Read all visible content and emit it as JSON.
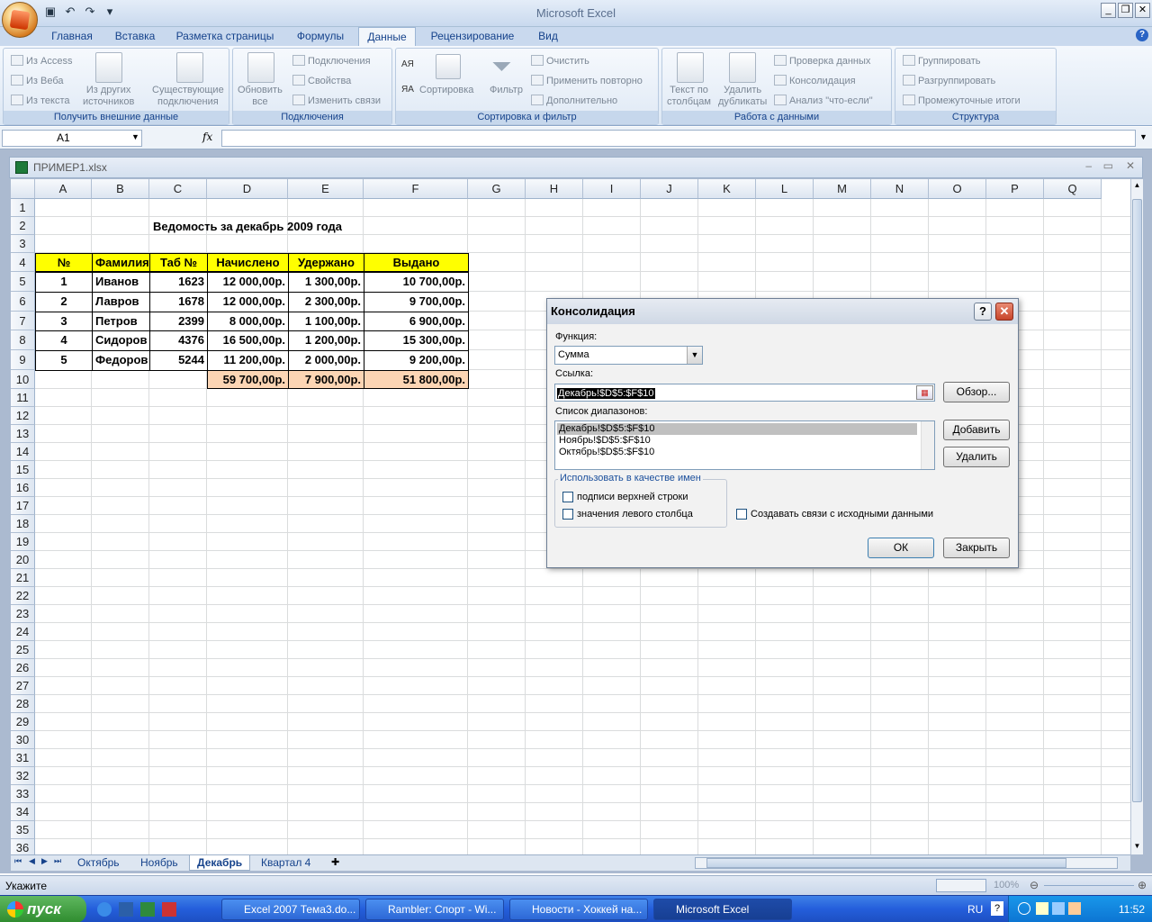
{
  "window": {
    "title": "Microsoft Excel"
  },
  "ribbon": {
    "tabs": [
      "Главная",
      "Вставка",
      "Разметка страницы",
      "Формулы",
      "Данные",
      "Рецензирование",
      "Вид"
    ],
    "active_tab": "Данные",
    "groups": {
      "external": {
        "label": "Получить внешние данные",
        "from_access": "Из Access",
        "from_web": "Из Веба",
        "from_text": "Из текста",
        "other_sources_1": "Из других",
        "other_sources_2": "источников",
        "existing_1": "Существующие",
        "existing_2": "подключения"
      },
      "connections": {
        "label": "Подключения",
        "refresh_1": "Обновить",
        "refresh_2": "все",
        "connections": "Подключения",
        "properties": "Свойства",
        "edit_links": "Изменить связи"
      },
      "sort_filter": {
        "label": "Сортировка и фильтр",
        "sort": "Сортировка",
        "filter": "Фильтр",
        "clear": "Очистить",
        "reapply": "Применить повторно",
        "advanced": "Дополнительно",
        "az": "АЯ",
        "za": "ЯА"
      },
      "data_tools": {
        "label": "Работа с данными",
        "text_to_cols_1": "Текст по",
        "text_to_cols_2": "столбцам",
        "remove_dup_1": "Удалить",
        "remove_dup_2": "дубликаты",
        "validation": "Проверка данных",
        "consolidate": "Консолидация",
        "whatif": "Анализ \"что-если\""
      },
      "outline": {
        "label": "Структура",
        "group": "Группировать",
        "ungroup": "Разгруппировать",
        "subtotal": "Промежуточные итоги"
      }
    }
  },
  "formula_bar": {
    "name_box": "A1",
    "fx": "fx"
  },
  "workbook": {
    "title": "ПРИМЕР1.xlsx"
  },
  "columns": [
    "A",
    "B",
    "C",
    "D",
    "E",
    "F",
    "G",
    "H",
    "I",
    "J",
    "K",
    "L",
    "M",
    "N",
    "O",
    "P",
    "Q"
  ],
  "rows": [
    "1",
    "2",
    "3",
    "4",
    "5",
    "6",
    "7",
    "8",
    "9",
    "10",
    "11",
    "12",
    "13",
    "14",
    "15",
    "16",
    "17",
    "18",
    "19",
    "20",
    "21",
    "22",
    "23",
    "24",
    "25",
    "26",
    "27",
    "28",
    "29",
    "30",
    "31",
    "32",
    "33",
    "34",
    "35",
    "36"
  ],
  "sheet": {
    "title": "Ведомость за декабрь 2009 года",
    "headers": [
      "№",
      "Фамилия",
      "Таб №",
      "Начислено",
      "Удержано",
      "Выдано"
    ],
    "data": [
      [
        "1",
        "Иванов",
        "1623",
        "12 000,00р.",
        "1 300,00р.",
        "10 700,00р."
      ],
      [
        "2",
        "Лавров",
        "1678",
        "12 000,00р.",
        "2 300,00р.",
        "9 700,00р."
      ],
      [
        "3",
        "Петров",
        "2399",
        "8 000,00р.",
        "1 100,00р.",
        "6 900,00р."
      ],
      [
        "4",
        "Сидоров",
        "4376",
        "16 500,00р.",
        "1 200,00р.",
        "15 300,00р."
      ],
      [
        "5",
        "Федоров",
        "5244",
        "11 200,00р.",
        "2 000,00р.",
        "9 200,00р."
      ]
    ],
    "totals": [
      "59 700,00р.",
      "7 900,00р.",
      "51 800,00р."
    ]
  },
  "sheet_tabs": [
    "Октябрь",
    "Ноябрь",
    "Декабрь",
    "Квартал 4"
  ],
  "active_sheet": "Декабрь",
  "status": {
    "mode": "Укажите",
    "zoom": "100%"
  },
  "dialog": {
    "title": "Консолидация",
    "function_label": "Функция:",
    "function_value": "Сумма",
    "reference_label": "Ссылка:",
    "reference_value": "Декабрь!$D$5:$F$10",
    "browse": "Обзор...",
    "ranges_label": "Список диапазонов:",
    "ranges": [
      "Декабрь!$D$5:$F$10",
      "Ноябрь!$D$5:$F$10",
      "Октябрь!$D$5:$F$10"
    ],
    "add": "Добавить",
    "delete": "Удалить",
    "use_labels": "Использовать в качестве имен",
    "top_row": "подписи верхней строки",
    "left_column": "значения левого столбца",
    "create_links": "Создавать связи с исходными данными",
    "ok": "ОК",
    "close": "Закрыть"
  },
  "taskbar": {
    "start": "пуск",
    "items": [
      "Excel 2007 Тема3.do...",
      "Rambler: Спорт - Wi...",
      "Новости - Хоккей на...",
      "Microsoft Excel"
    ],
    "lang": "RU",
    "time": "11:52"
  }
}
